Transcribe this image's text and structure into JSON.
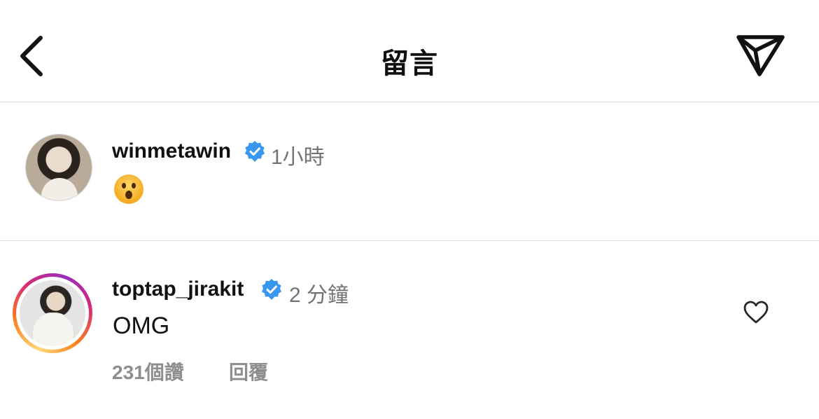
{
  "header": {
    "title": "留言",
    "back_icon": "chevron-left-icon",
    "share_icon": "paper-plane-icon"
  },
  "caption": {
    "username": "winmetawin",
    "verified": true,
    "time": "1小時",
    "text_emoji": "😮"
  },
  "comment": {
    "username": "toptap_jirakit",
    "verified": true,
    "time": "2 分鐘",
    "text": "OMG",
    "likes": "231個讚",
    "reply_label": "回覆",
    "like_icon": "heart-outline-icon"
  },
  "colors": {
    "verified_blue": "#3897f0",
    "secondary_text": "#737373",
    "divider": "#dbdbdb"
  }
}
